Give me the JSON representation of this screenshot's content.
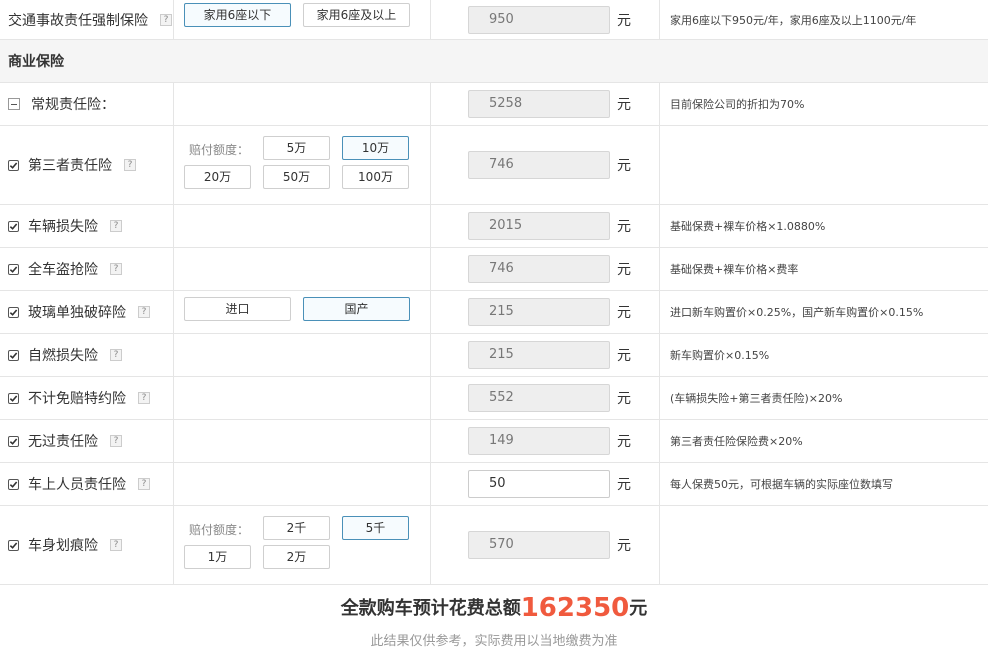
{
  "compulsory": {
    "label": "交通事故责任强制保险",
    "options": [
      "家用6座以下",
      "家用6座及以上"
    ],
    "selected": 0,
    "amount": "950",
    "unit": "元",
    "note": "家用6座以下950元/年，家用6座及以上1100元/年"
  },
  "commercial": {
    "title": "商业保险",
    "general_liability": {
      "label": "常规责任险：",
      "amount": "5258",
      "unit": "元",
      "note": "目前保险公司的折扣为70%"
    }
  },
  "icons": {
    "checkbox": "checkbox-checked-icon",
    "help": "help-icon",
    "collapse": "collapse-icon"
  },
  "help_glyph": "?",
  "rows": [
    {
      "key": "third_party",
      "label": "第三者责任险",
      "checked": true,
      "caption": "赔付额度：",
      "options": [
        "5万",
        "10万",
        "20万",
        "50万",
        "100万"
      ],
      "selected": 1,
      "amount": "746",
      "unit": "元",
      "note": ""
    },
    {
      "key": "vehicle_loss",
      "label": "车辆损失险",
      "checked": true,
      "amount": "2015",
      "unit": "元",
      "note": "基础保费+裸车价格×1.0880%"
    },
    {
      "key": "theft",
      "label": "全车盗抢险",
      "checked": true,
      "amount": "746",
      "unit": "元",
      "note": "基础保费+裸车价格×费率"
    },
    {
      "key": "glass",
      "label": "玻璃单独破碎险",
      "checked": true,
      "options": [
        "进口",
        "国产"
      ],
      "selected": 1,
      "amount": "215",
      "unit": "元",
      "note": "进口新车购置价×0.25%，国产新车购置价×0.15%"
    },
    {
      "key": "self_ignition",
      "label": "自燃损失险",
      "checked": true,
      "amount": "215",
      "unit": "元",
      "note": "新车购置价×0.15%"
    },
    {
      "key": "deductible",
      "label": "不计免赔特约险",
      "checked": true,
      "amount": "552",
      "unit": "元",
      "note": "(车辆损失险+第三者责任险)×20%"
    },
    {
      "key": "no_fault",
      "label": "无过责任险",
      "checked": true,
      "amount": "149",
      "unit": "元",
      "note": "第三者责任险保险费×20%"
    },
    {
      "key": "passenger",
      "label": "车上人员责任险",
      "checked": true,
      "amount": "50",
      "editable": true,
      "unit": "元",
      "note": "每人保费50元，可根据车辆的实际座位数填写"
    },
    {
      "key": "scratch",
      "label": "车身划痕险",
      "checked": true,
      "caption": "赔付额度：",
      "options": [
        "2千",
        "5千",
        "1万",
        "2万"
      ],
      "selected": 1,
      "amount": "570",
      "unit": "元",
      "note": ""
    }
  ],
  "summary": {
    "prefix": "全款购车预计花费总额",
    "total": "162350",
    "suffix": "元",
    "disclaimer": "此结果仅供参考，实际费用以当地缴费为准"
  }
}
